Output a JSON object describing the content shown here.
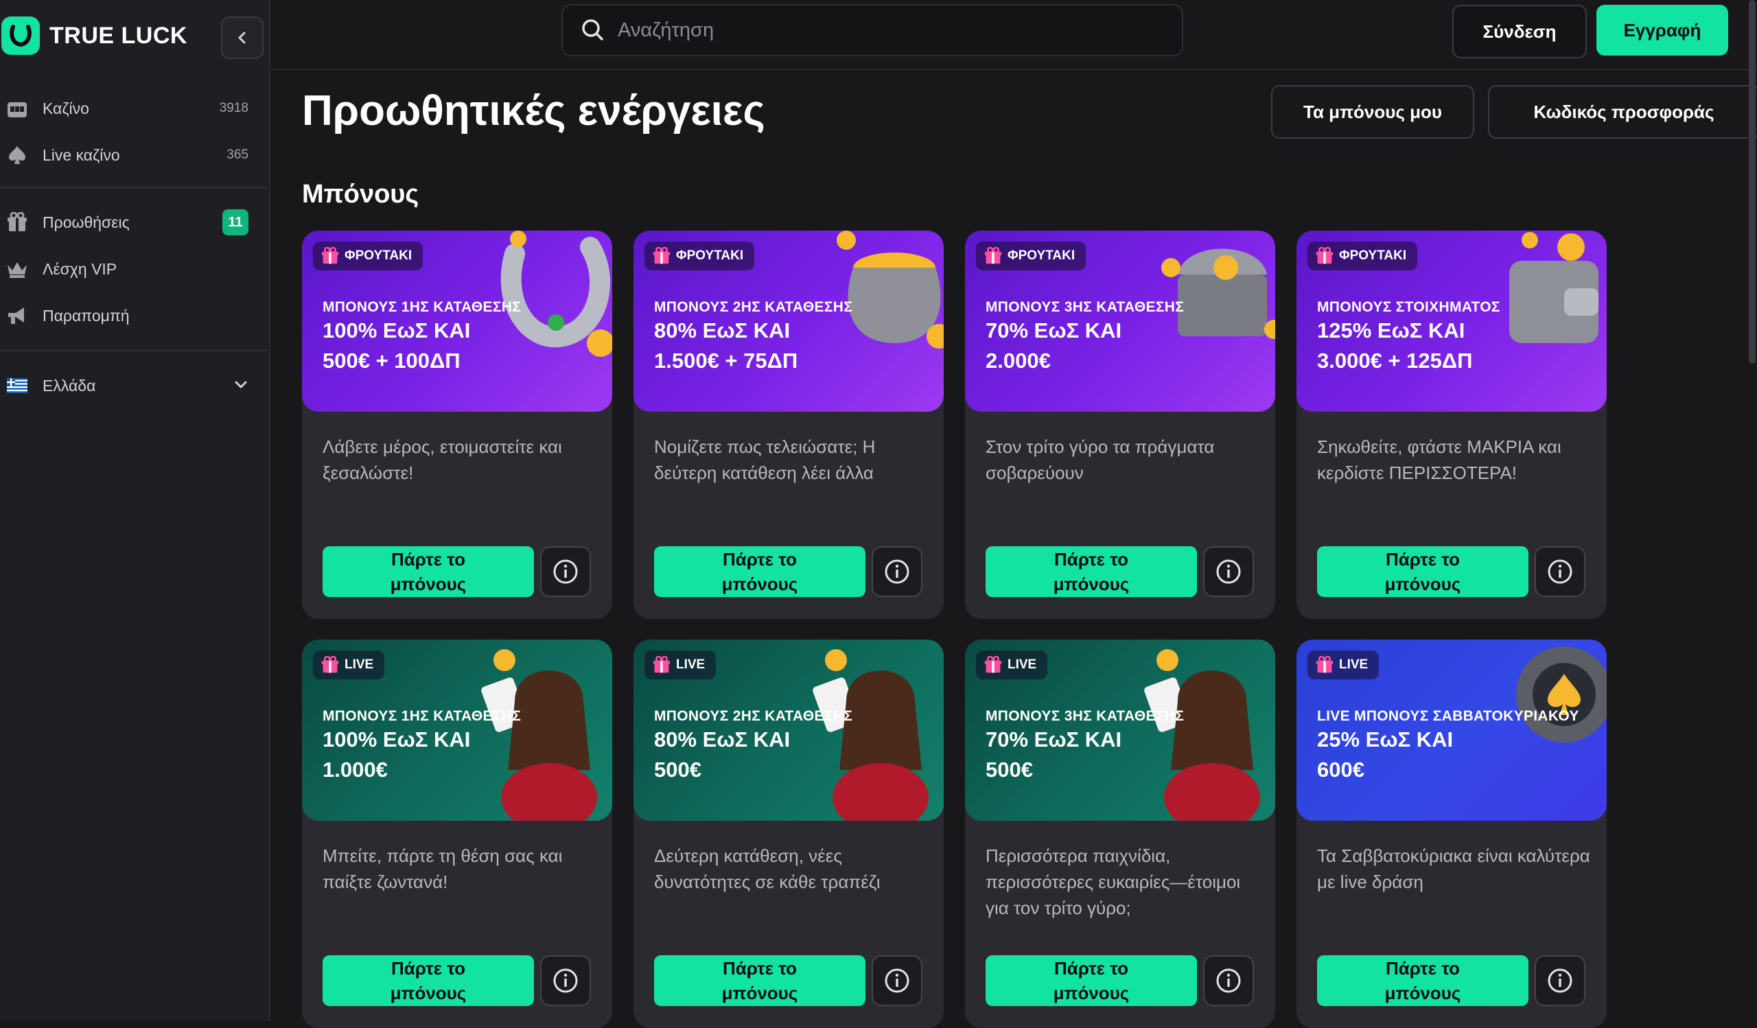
{
  "brand": {
    "name": "TRUE LUCK",
    "accent": "#12e3a3"
  },
  "sidebar": {
    "items": [
      {
        "label": "Καζίνο",
        "count": "3918",
        "icon": "slot-machine-icon"
      },
      {
        "label": "Live καζίνο",
        "count": "365",
        "icon": "spade-icon"
      },
      {
        "label": "Προωθήσεις",
        "count": "11",
        "icon": "gift-icon"
      },
      {
        "label": "Λέσχη VIP",
        "count": "",
        "icon": "crown-icon"
      },
      {
        "label": "Παραπομπή",
        "count": "",
        "icon": "megaphone-icon"
      }
    ],
    "country": {
      "label": "Ελλάδα",
      "icon": "greece-flag-icon"
    }
  },
  "header": {
    "search_placeholder": "Αναζήτηση",
    "login_label": "Σύνδεση",
    "register_label": "Εγγραφή"
  },
  "main": {
    "title": "Προωθητικές ενέργειες",
    "my_bonuses_label": "Τα μπόνους μου",
    "promo_code_label": "Κωδικός προσφοράς",
    "section_title": "Μπόνους",
    "cta_label_line1": "Πάρτε το",
    "cta_label_line2": "μπόνους",
    "cards": [
      {
        "tag": "ΦΡΟΥΤΑΚΙ",
        "theme": "purple",
        "art": "horseshoe",
        "subtitle": "ΜΠΟΝΟΥΣ 1ΗΣ ΚΑΤΑΘΕΣΗΣ",
        "line1": "100% ΕωΣ ΚΑΙ",
        "line2": "500€ + 100ΔΠ",
        "desc": "Λάβετε μέρος, ετοιμαστείτε και ξεσαλώστε!"
      },
      {
        "tag": "ΦΡΟΥΤΑΚΙ",
        "theme": "purple",
        "art": "coin-pot",
        "subtitle": "ΜΠΟΝΟΥΣ 2ΗΣ ΚΑΤΑΘΕΣΗΣ",
        "line1": "80% ΕωΣ ΚΑΙ",
        "line2": "1.500€ + 75ΔΠ",
        "desc": "Νομίζετε πως τελειώσατε; Η δεύτερη κατάθεση λέει άλλα"
      },
      {
        "tag": "ΦΡΟΥΤΑΚΙ",
        "theme": "purple",
        "art": "treasure-chest",
        "subtitle": "ΜΠΟΝΟΥΣ 3ΗΣ ΚΑΤΑΘΕΣΗΣ",
        "line1": "70% ΕωΣ ΚΑΙ",
        "line2": "2.000€",
        "desc": "Στον τρίτο γύρο τα πράγματα σοβαρεύουν"
      },
      {
        "tag": "ΦΡΟΥΤΑΚΙ",
        "theme": "purple",
        "art": "wallet",
        "subtitle": "ΜΠΟΝΟΥΣ ΣΤΟΙΧΗΜΑΤΟΣ",
        "line1": "125% ΕωΣ ΚΑΙ",
        "line2": "3.000€ + 125ΔΠ",
        "desc": "Σηκωθείτε, φτάστε ΜΑΚΡΙΑ και κερδίστε ΠΕΡΙΣΣΟΤΕΡΑ!"
      },
      {
        "tag": "LIVE",
        "theme": "green",
        "art": "dealer",
        "subtitle": "ΜΠΟΝΟΥΣ 1ΗΣ ΚΑΤΑΘΕΣΗΣ",
        "line1": "100% ΕωΣ ΚΑΙ",
        "line2": "1.000€",
        "desc": "Μπείτε, πάρτε τη θέση σας και παίξτε ζωντανά!"
      },
      {
        "tag": "LIVE",
        "theme": "green",
        "art": "dealer",
        "subtitle": "ΜΠΟΝΟΥΣ 2ΗΣ ΚΑΤΑΘΕΣΗΣ",
        "line1": "80% ΕωΣ ΚΑΙ",
        "line2": "500€",
        "desc": "Δεύτερη κατάθεση, νέες δυνατότητες σε κάθε τραπέζι"
      },
      {
        "tag": "LIVE",
        "theme": "green",
        "art": "dealer",
        "subtitle": "ΜΠΟΝΟΥΣ 3ΗΣ ΚΑΤΑΘΕΣΗΣ",
        "line1": "70% ΕωΣ ΚΑΙ",
        "line2": "500€",
        "desc": "Περισσότερα παιχνίδια, περισσότερες ευκαιρίες—έτοιμοι για τον τρίτο γύρο;"
      },
      {
        "tag": "LIVE",
        "theme": "blue",
        "art": "chip",
        "subtitle": "LIVE ΜΠΟΝΟΥΣ ΣΑΒΒΑΤΟΚΥΡΙΑΚΟΥ",
        "line1": "25% ΕωΣ ΚΑΙ",
        "line2": "600€",
        "desc": "Τα Σαββατοκύριακα είναι καλύτερα με live δράση"
      }
    ]
  }
}
